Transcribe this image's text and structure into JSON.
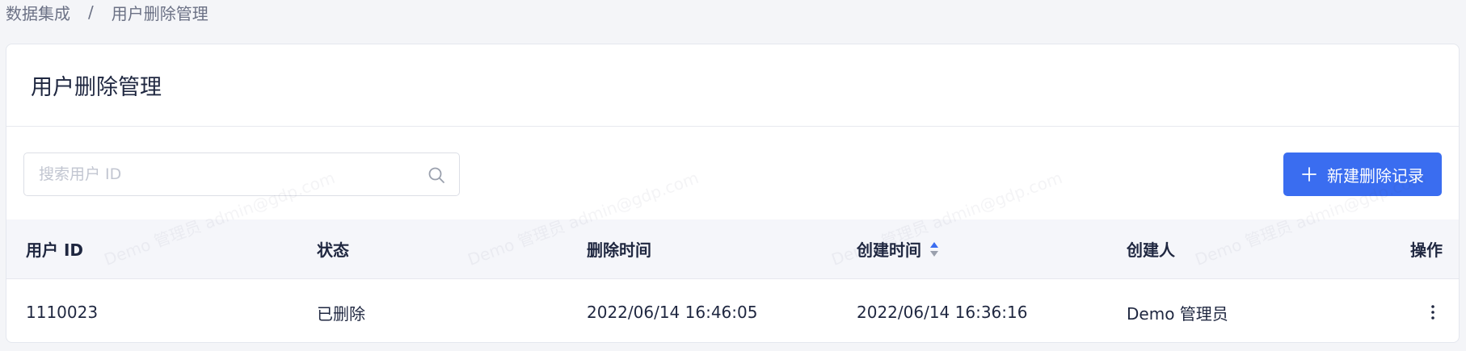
{
  "breadcrumb": {
    "parent": "数据集成",
    "separator": "/",
    "current": "用户删除管理"
  },
  "page": {
    "title": "用户删除管理"
  },
  "search": {
    "placeholder": "搜索用户 ID",
    "value": ""
  },
  "actions": {
    "new_record_label": "新建删除记录"
  },
  "table": {
    "columns": [
      "用户 ID",
      "状态",
      "删除时间",
      "创建时间",
      "创建人",
      "操作"
    ],
    "sorted_column": "创建时间",
    "rows": [
      {
        "user_id": "1110023",
        "status": "已删除",
        "deleted_at": "2022/06/14 16:46:05",
        "created_at": "2022/06/14 16:36:16",
        "creator": "Demo 管理员"
      }
    ]
  },
  "watermark": {
    "text": "Demo 管理员 admin@gdp.com"
  },
  "colors": {
    "primary": "#3a6df0",
    "text": "#1f2740",
    "muted": "#6b7185",
    "background": "#f4f5f8",
    "header_bg": "#f5f6fa"
  },
  "icons": {
    "search": "search-icon",
    "add": "plus-icon",
    "sort": "sort-icon",
    "more": "more-vertical-icon"
  }
}
